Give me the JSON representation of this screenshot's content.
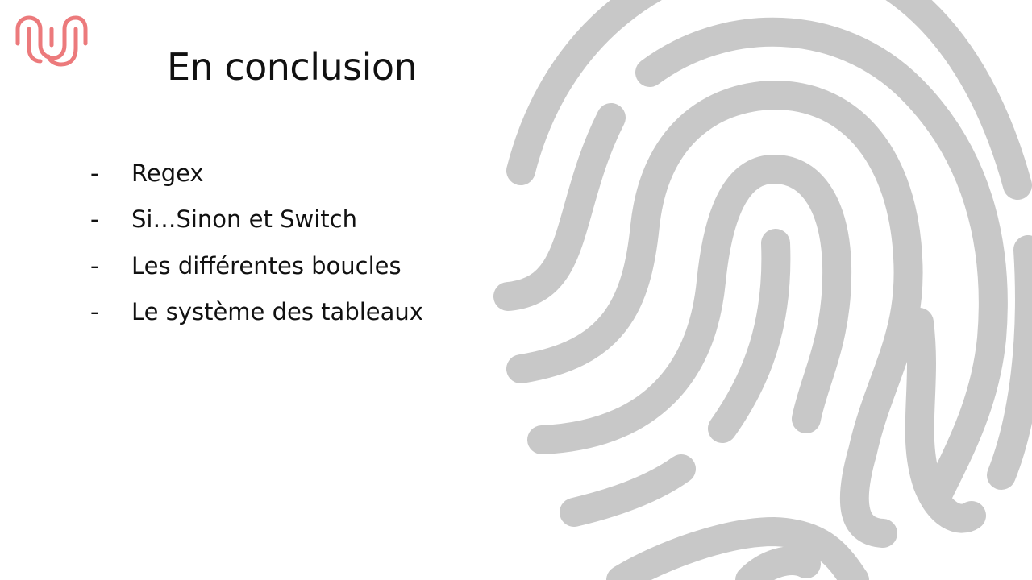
{
  "slide": {
    "title": "En conclusion",
    "bullets": [
      {
        "marker": "-",
        "text": "Regex"
      },
      {
        "marker": "-",
        "text": "Si…Sinon et Switch"
      },
      {
        "marker": "-",
        "text": "Les différentes boucles"
      },
      {
        "marker": "-",
        "text": "Le système des tableaux"
      }
    ]
  },
  "colors": {
    "logo": "#ec7a7c",
    "fingerprint": "#c8c8c8",
    "background": "#ffffff",
    "text": "#111111"
  },
  "icons": {
    "logo": "brand-logo-icon",
    "decoration": "fingerprint-icon"
  }
}
